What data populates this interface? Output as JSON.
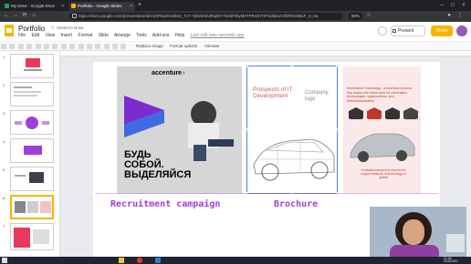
{
  "browser": {
    "tabs": [
      {
        "title": "My Drive - Google Drive",
        "icon": "google-drive-icon",
        "active": false
      },
      {
        "title": "Portfolio - Google Slides",
        "icon": "google-slides-icon",
        "active": true
      }
    ],
    "new_tab": "+",
    "url": "https://docs.google.com/presentation/d/1GhP6uGNUEDr_Tz7-YjEzbrDURtqWY7dvbFtNyM0TPR4ZYhFmdtdovVdfzR5S0B1F_0_0a",
    "zoom": "90%"
  },
  "app": {
    "title": "Portfolio",
    "saved_status": "Saved to Drive",
    "menu": [
      "File",
      "Edit",
      "View",
      "Insert",
      "Format",
      "Slide",
      "Arrange",
      "Tools",
      "Add-ons",
      "Help"
    ],
    "last_edit": "Last edit was seconds ago",
    "present_label": "Present",
    "share_label": "Share",
    "toolbar": {
      "replace_image": "Replace image",
      "format_options": "Format options",
      "animate": "Animate"
    }
  },
  "filmstrip": {
    "slides": [
      {
        "n": "1",
        "label": "portfolio"
      },
      {
        "n": "2",
        "label": ""
      },
      {
        "n": "3",
        "label": ""
      },
      {
        "n": "4",
        "label": ""
      },
      {
        "n": "5",
        "label": ""
      },
      {
        "n": "6",
        "label": ""
      },
      {
        "n": "7",
        "label": ""
      }
    ]
  },
  "slide": {
    "left_card": {
      "brand": "accenture",
      "headline_l1": "БУДЬ",
      "headline_l2": "СОБОЙ.",
      "headline_l3": "ВЫДЕЛЯЙСЯ"
    },
    "middle_card": {
      "prospects": "Prospects of IT Development",
      "company_logo": "Company logo"
    },
    "right_card": {
      "heading": "Information Technology - a business process that makes the future work for information technologies, organizations, and telecommunication",
      "footer": "A reliable transport is required to support features of technology in global"
    },
    "captions": [
      "Recruitment campaign",
      "Brochure"
    ]
  },
  "taskbar": {
    "time": "11:48",
    "date": "5/26/2020"
  },
  "colors": {
    "accent": "#f4b400",
    "caption": "#a03fd8",
    "selection": "#4a80f5"
  }
}
